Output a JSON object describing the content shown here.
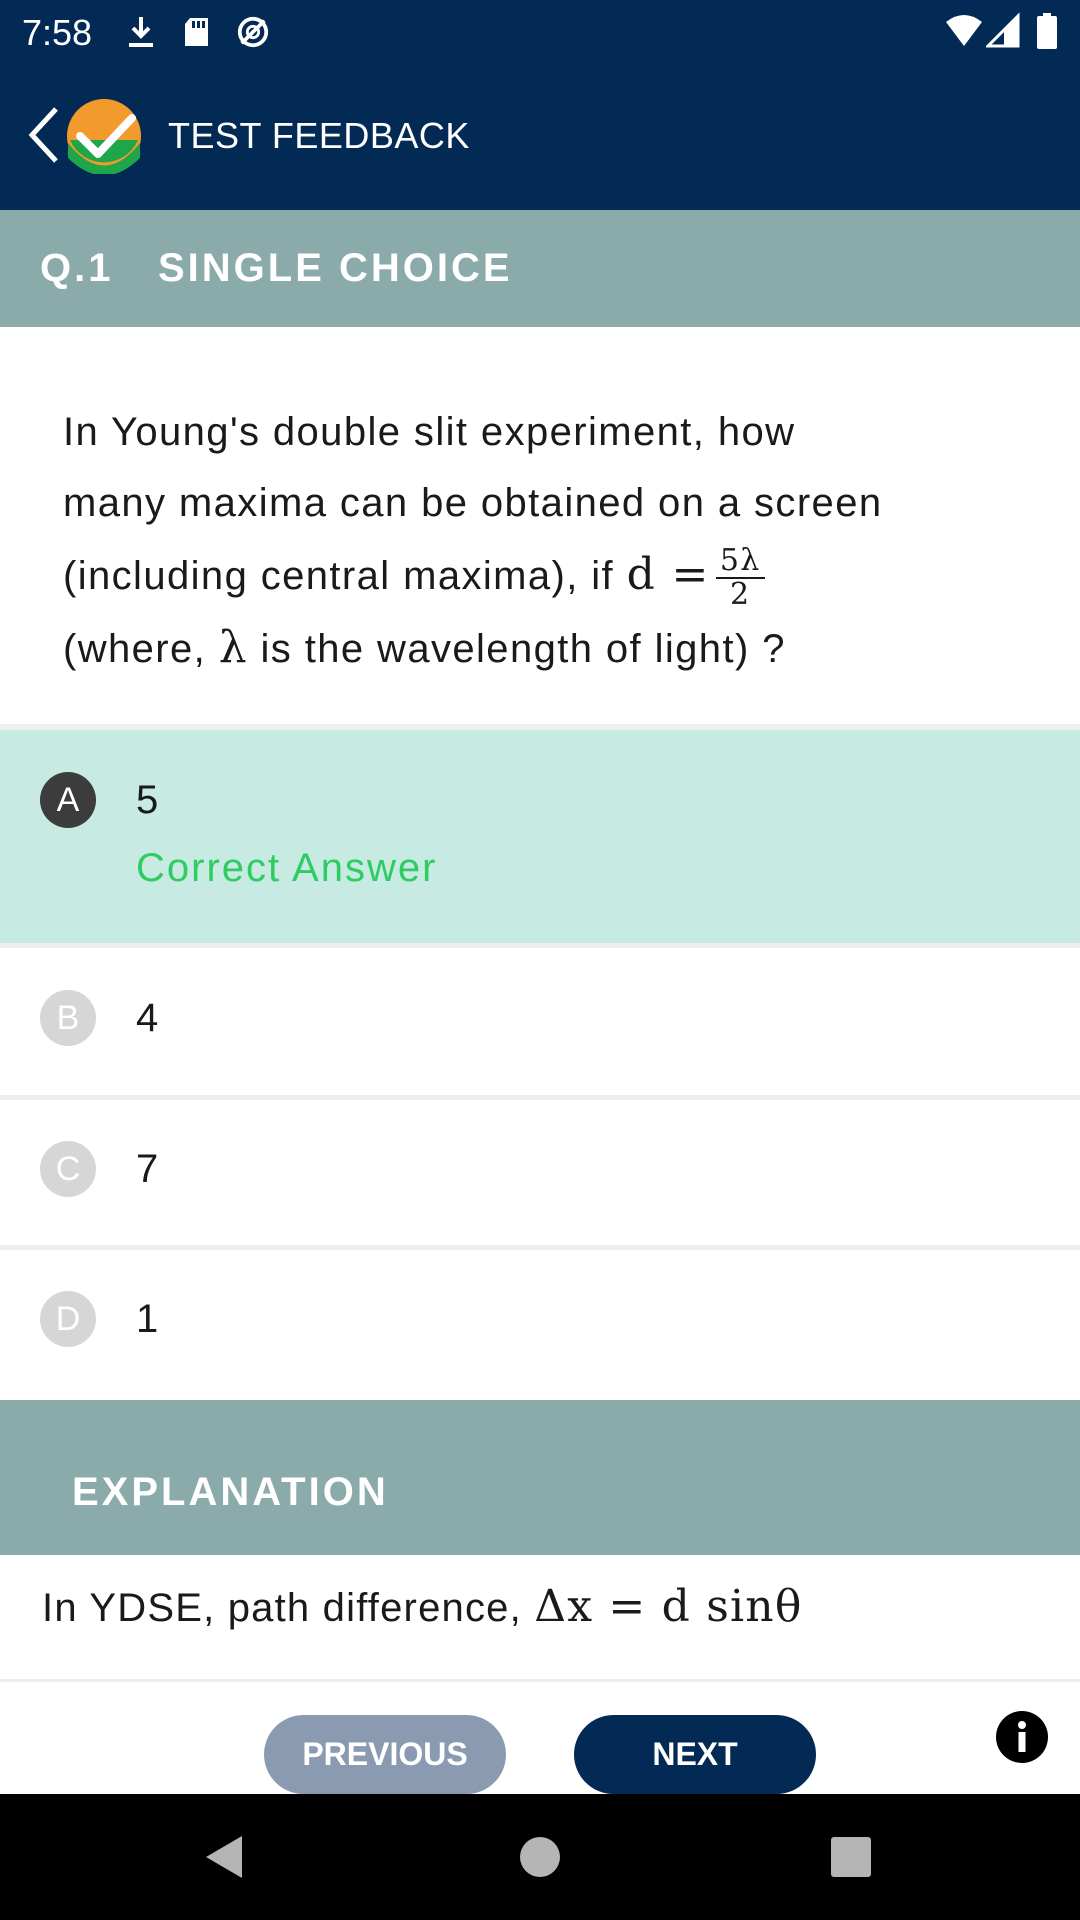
{
  "status_bar": {
    "time": "7:58",
    "left_icons": [
      "download-icon",
      "sd-card-icon",
      "sync-icon"
    ],
    "right_icons": [
      "wifi-icon",
      "signal-icon",
      "battery-icon"
    ]
  },
  "app_bar": {
    "title": "TEST FEEDBACK"
  },
  "question": {
    "number": "Q.1",
    "type": "SINGLE CHOICE",
    "text_line1": "In Young's double slit experiment, how",
    "text_line2": "many maxima can be obtained on a screen",
    "text_line3_pre": "(including central maxima), if ",
    "text_line3_math": "d =",
    "frac_num": "5λ",
    "frac_den": "2",
    "text_line4_pre": "(where, ",
    "text_line4_math": "λ",
    "text_line4_post": " is the wavelength of light) ?"
  },
  "options": [
    {
      "letter": "A",
      "value": "5",
      "status": "Correct Answer"
    },
    {
      "letter": "B",
      "value": "4"
    },
    {
      "letter": "C",
      "value": "7"
    },
    {
      "letter": "D",
      "value": "1"
    }
  ],
  "explanation": {
    "title": "EXPLANATION",
    "text_pre": "In YDSE, path difference, ",
    "text_math": "Δx = d sinθ"
  },
  "nav": {
    "previous_label": "PREVIOUS",
    "next_label": "NEXT"
  },
  "colors": {
    "primary": "#022a55",
    "header_teal": "#8baaaa",
    "correct_bg": "#c7ebe2",
    "correct_text": "#2ecc61",
    "prev_button": "#8a9bb1"
  }
}
